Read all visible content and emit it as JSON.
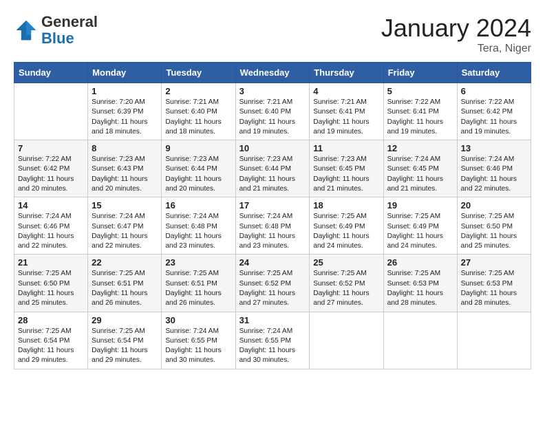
{
  "header": {
    "logo_general": "General",
    "logo_blue": "Blue",
    "month_title": "January 2024",
    "location": "Tera, Niger"
  },
  "weekdays": [
    "Sunday",
    "Monday",
    "Tuesday",
    "Wednesday",
    "Thursday",
    "Friday",
    "Saturday"
  ],
  "weeks": [
    [
      {
        "day": "",
        "info": ""
      },
      {
        "day": "1",
        "info": "Sunrise: 7:20 AM\nSunset: 6:39 PM\nDaylight: 11 hours\nand 18 minutes."
      },
      {
        "day": "2",
        "info": "Sunrise: 7:21 AM\nSunset: 6:40 PM\nDaylight: 11 hours\nand 18 minutes."
      },
      {
        "day": "3",
        "info": "Sunrise: 7:21 AM\nSunset: 6:40 PM\nDaylight: 11 hours\nand 19 minutes."
      },
      {
        "day": "4",
        "info": "Sunrise: 7:21 AM\nSunset: 6:41 PM\nDaylight: 11 hours\nand 19 minutes."
      },
      {
        "day": "5",
        "info": "Sunrise: 7:22 AM\nSunset: 6:41 PM\nDaylight: 11 hours\nand 19 minutes."
      },
      {
        "day": "6",
        "info": "Sunrise: 7:22 AM\nSunset: 6:42 PM\nDaylight: 11 hours\nand 19 minutes."
      }
    ],
    [
      {
        "day": "7",
        "info": "Sunrise: 7:22 AM\nSunset: 6:42 PM\nDaylight: 11 hours\nand 20 minutes."
      },
      {
        "day": "8",
        "info": "Sunrise: 7:23 AM\nSunset: 6:43 PM\nDaylight: 11 hours\nand 20 minutes."
      },
      {
        "day": "9",
        "info": "Sunrise: 7:23 AM\nSunset: 6:44 PM\nDaylight: 11 hours\nand 20 minutes."
      },
      {
        "day": "10",
        "info": "Sunrise: 7:23 AM\nSunset: 6:44 PM\nDaylight: 11 hours\nand 21 minutes."
      },
      {
        "day": "11",
        "info": "Sunrise: 7:23 AM\nSunset: 6:45 PM\nDaylight: 11 hours\nand 21 minutes."
      },
      {
        "day": "12",
        "info": "Sunrise: 7:24 AM\nSunset: 6:45 PM\nDaylight: 11 hours\nand 21 minutes."
      },
      {
        "day": "13",
        "info": "Sunrise: 7:24 AM\nSunset: 6:46 PM\nDaylight: 11 hours\nand 22 minutes."
      }
    ],
    [
      {
        "day": "14",
        "info": "Sunrise: 7:24 AM\nSunset: 6:46 PM\nDaylight: 11 hours\nand 22 minutes."
      },
      {
        "day": "15",
        "info": "Sunrise: 7:24 AM\nSunset: 6:47 PM\nDaylight: 11 hours\nand 22 minutes."
      },
      {
        "day": "16",
        "info": "Sunrise: 7:24 AM\nSunset: 6:48 PM\nDaylight: 11 hours\nand 23 minutes."
      },
      {
        "day": "17",
        "info": "Sunrise: 7:24 AM\nSunset: 6:48 PM\nDaylight: 11 hours\nand 23 minutes."
      },
      {
        "day": "18",
        "info": "Sunrise: 7:25 AM\nSunset: 6:49 PM\nDaylight: 11 hours\nand 24 minutes."
      },
      {
        "day": "19",
        "info": "Sunrise: 7:25 AM\nSunset: 6:49 PM\nDaylight: 11 hours\nand 24 minutes."
      },
      {
        "day": "20",
        "info": "Sunrise: 7:25 AM\nSunset: 6:50 PM\nDaylight: 11 hours\nand 25 minutes."
      }
    ],
    [
      {
        "day": "21",
        "info": "Sunrise: 7:25 AM\nSunset: 6:50 PM\nDaylight: 11 hours\nand 25 minutes."
      },
      {
        "day": "22",
        "info": "Sunrise: 7:25 AM\nSunset: 6:51 PM\nDaylight: 11 hours\nand 26 minutes."
      },
      {
        "day": "23",
        "info": "Sunrise: 7:25 AM\nSunset: 6:51 PM\nDaylight: 11 hours\nand 26 minutes."
      },
      {
        "day": "24",
        "info": "Sunrise: 7:25 AM\nSunset: 6:52 PM\nDaylight: 11 hours\nand 27 minutes."
      },
      {
        "day": "25",
        "info": "Sunrise: 7:25 AM\nSunset: 6:52 PM\nDaylight: 11 hours\nand 27 minutes."
      },
      {
        "day": "26",
        "info": "Sunrise: 7:25 AM\nSunset: 6:53 PM\nDaylight: 11 hours\nand 28 minutes."
      },
      {
        "day": "27",
        "info": "Sunrise: 7:25 AM\nSunset: 6:53 PM\nDaylight: 11 hours\nand 28 minutes."
      }
    ],
    [
      {
        "day": "28",
        "info": "Sunrise: 7:25 AM\nSunset: 6:54 PM\nDaylight: 11 hours\nand 29 minutes."
      },
      {
        "day": "29",
        "info": "Sunrise: 7:25 AM\nSunset: 6:54 PM\nDaylight: 11 hours\nand 29 minutes."
      },
      {
        "day": "30",
        "info": "Sunrise: 7:24 AM\nSunset: 6:55 PM\nDaylight: 11 hours\nand 30 minutes."
      },
      {
        "day": "31",
        "info": "Sunrise: 7:24 AM\nSunset: 6:55 PM\nDaylight: 11 hours\nand 30 minutes."
      },
      {
        "day": "",
        "info": ""
      },
      {
        "day": "",
        "info": ""
      },
      {
        "day": "",
        "info": ""
      }
    ]
  ]
}
